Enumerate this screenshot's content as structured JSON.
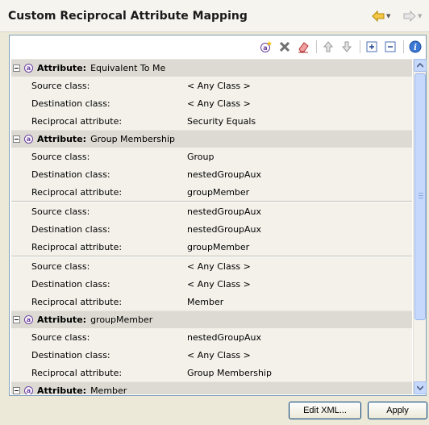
{
  "header": {
    "title": "Custom Reciprocal Attribute Mapping",
    "back_icon": "arrow-left-icon",
    "forward_icon": "arrow-right-icon"
  },
  "toolbar": {
    "icons": [
      "add-attribute-icon",
      "delete-icon",
      "eraser-icon",
      "move-up-icon",
      "move-down-icon",
      "expand-all-icon",
      "collapse-all-icon",
      "info-icon"
    ]
  },
  "labels": {
    "attribute": "Attribute:",
    "source": "Source class:",
    "destination": "Destination class:",
    "reciprocal": "Reciprocal attribute:"
  },
  "groups": [
    {
      "name": "Equivalent To Me",
      "mappings": [
        {
          "source": "< Any Class >",
          "destination": "< Any Class >",
          "reciprocal": "Security Equals"
        }
      ]
    },
    {
      "name": "Group Membership",
      "mappings": [
        {
          "source": "Group",
          "destination": "nestedGroupAux",
          "reciprocal": "groupMember"
        },
        {
          "source": "nestedGroupAux",
          "destination": "nestedGroupAux",
          "reciprocal": "groupMember"
        },
        {
          "source": "< Any Class >",
          "destination": "< Any Class >",
          "reciprocal": "Member"
        }
      ]
    },
    {
      "name": "groupMember",
      "mappings": [
        {
          "source": "nestedGroupAux",
          "destination": "< Any Class >",
          "reciprocal": "Group Membership"
        }
      ]
    },
    {
      "name": "Member",
      "mappings": []
    }
  ],
  "buttons": {
    "edit_xml": "Edit XML...",
    "apply": "Apply"
  }
}
